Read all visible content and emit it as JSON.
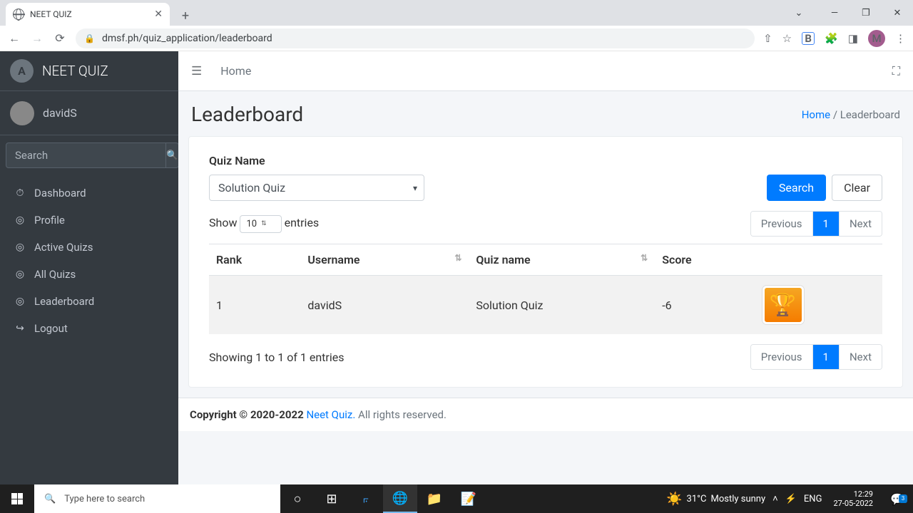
{
  "browser": {
    "tab_title": "NEET QUIZ",
    "url": "dmsf.ph/quiz_application/leaderboard",
    "avatar_letter": "M"
  },
  "sidebar": {
    "brand": "NEET QUIZ",
    "brand_logo": "A",
    "username": "davidS",
    "search_placeholder": "Search",
    "items": [
      {
        "icon": "⏱",
        "label": "Dashboard"
      },
      {
        "icon": "◎",
        "label": "Profile"
      },
      {
        "icon": "◎",
        "label": "Active Quizs"
      },
      {
        "icon": "◎",
        "label": "All Quizs"
      },
      {
        "icon": "◎",
        "label": "Leaderboard"
      },
      {
        "icon": "↪",
        "label": "Logout"
      }
    ]
  },
  "topbar": {
    "home": "Home"
  },
  "header": {
    "title": "Leaderboard",
    "breadcrumb_home": "Home",
    "breadcrumb_current": "Leaderboard"
  },
  "card": {
    "quiz_name_label": "Quiz Name",
    "selected_quiz": "Solution Quiz",
    "search_btn": "Search",
    "clear_btn": "Clear",
    "show_label": "Show",
    "entries_label": "entries",
    "entries_count": "10",
    "prev": "Previous",
    "page": "1",
    "next": "Next",
    "columns": {
      "rank": "Rank",
      "username": "Username",
      "quizname": "Quiz name",
      "score": "Score"
    },
    "rows": [
      {
        "rank": "1",
        "username": "davidS",
        "quizname": "Solution Quiz",
        "score": "-6"
      }
    ],
    "info": "Showing 1 to 1 of 1 entries"
  },
  "footer": {
    "copyright": "Copyright © 2020-2022 ",
    "brand": "Neet Quiz.",
    "rights": " All rights reserved."
  },
  "taskbar": {
    "search_placeholder": "Type here to search",
    "weather_temp": "31°C",
    "weather_text": "Mostly sunny",
    "lang": "ENG",
    "time": "12:29",
    "date": "27-05-2022",
    "notif_count": "3"
  }
}
